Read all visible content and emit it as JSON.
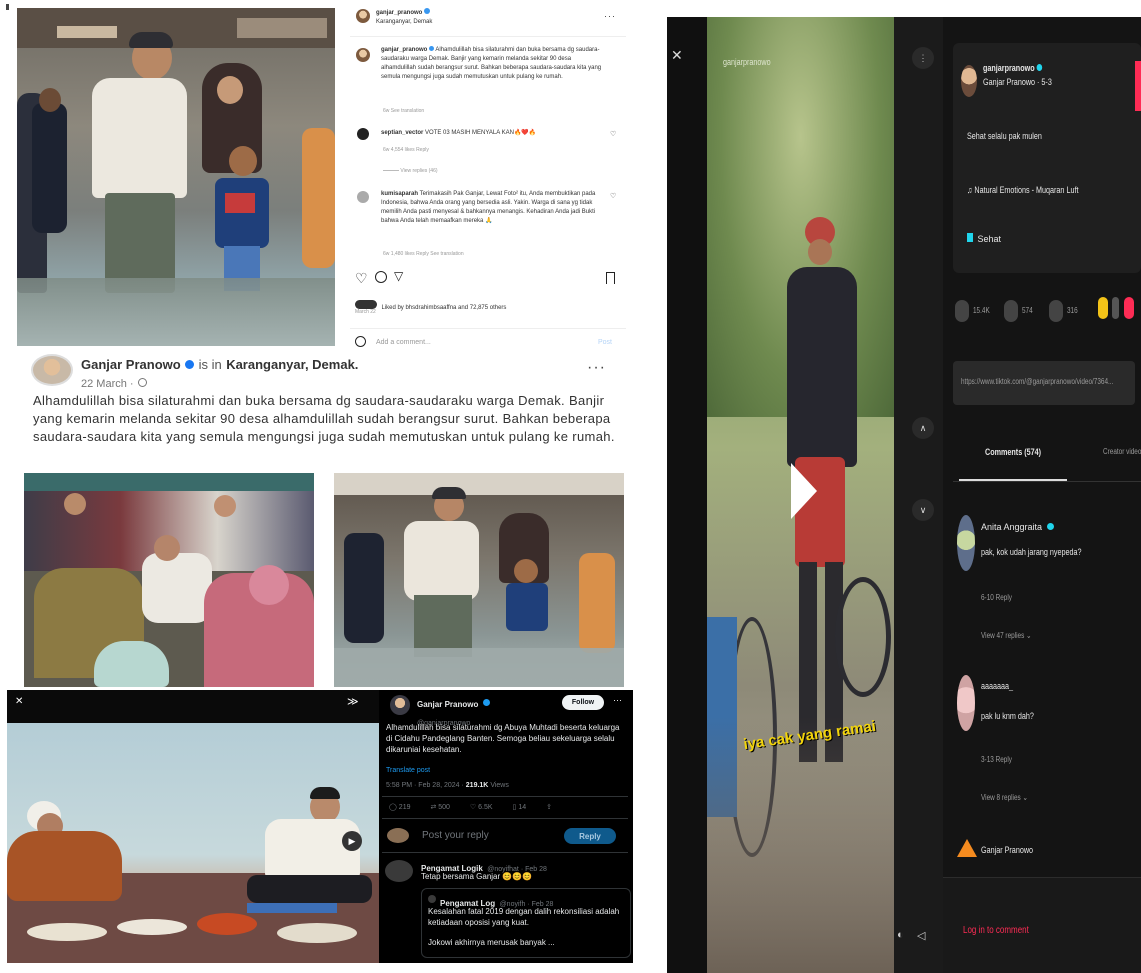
{
  "instagram": {
    "header": {
      "username": "ganjar_pranowo",
      "location": "Karanganyar, Demak"
    },
    "caption": {
      "username": "ganjar_pranowo",
      "text": "Alhamdulillah bisa silaturahmi dan buka bersama dg saudara-saudaraku warga Demak. Banjir yang kemarin melanda sekitar 90 desa alhamdulillah sudah berangsur surut. Bahkan beberapa saudara-saudara kita yang semula mengungsi juga sudah memutuskan untuk pulang ke rumah.",
      "meta": "6w   See translation"
    },
    "comments": [
      {
        "username": "septian_vector",
        "text": "VOTE 03 MASIH MENYALA KAN🔥❤️🔥",
        "meta": "6w   4,554 likes   Reply",
        "replies": "View replies (46)"
      },
      {
        "username": "kumisaparah",
        "text": "Terimakasih Pak Ganjar, Lewat Foto² itu, Anda membuktikan pada Indonesia, bahwa Anda orang yang bersedia asli. Yakin. Warga di sana yg tidak memilih Anda pasti menyesal & bahkannya menangis. Kehadiran Anda jadi Bukti bahwa Anda telah memaafkan mereka 🙏",
        "meta": "6w   1,480 likes   Reply   See translation"
      }
    ],
    "likes": "Liked by bhsdrahimbsaaffna and 72,875 others",
    "date": "March 22",
    "comment_placeholder": "Add a comment...",
    "post_label": "Post"
  },
  "facebook": {
    "name": "Ganjar Pranowo",
    "is_in": "is in",
    "location": "Karanganyar, Demak.",
    "date": "22 March ·",
    "text": "Alhamdulillah bisa silaturahmi dan buka bersama dg saudara-saudaraku warga Demak. Banjir yang kemarin melanda sekitar 90 desa alhamdulillah sudah berangsur surut. Bahkan beberapa saudara-saudara kita yang semula mengungsi juga sudah memutuskan untuk pulang ke rumah."
  },
  "twitter": {
    "name": "Ganjar Pranowo",
    "handle": "@ganjarpranowo",
    "follow_label": "Follow",
    "text": "Alhamdulillah bisa silaturahmi dg Abuya Muhtadi beserta keluarga di Cidahu Pandeglang Banten. Semoga beliau sekeluarga selalu dikaruniai kesehatan.",
    "translate": "Translate post",
    "timestamp": "5:58 PM · Feb 28, 2024 ·",
    "views": "219.1K",
    "views_label": "Views",
    "stats": {
      "replies": "219",
      "reposts": "500",
      "likes": "6.5K",
      "bookmarks": "14"
    },
    "reply_placeholder": "Post your reply",
    "reply_button": "Reply",
    "replies": [
      {
        "name": "Pengamat Logik",
        "handle": "@noyifhat · Feb 28",
        "text": "Tetap bersama Ganjar 😊😊😊"
      },
      {
        "name": "Pengamat Log",
        "handle": "@noyifh · Feb 28",
        "text": "Kesalahan fatal 2019 dengan dalih rekonsiliasi adalah ketiadaan oposisi yang kuat.",
        "more": "Jokowi akhirnya merusak banyak ..."
      }
    ]
  },
  "tiktok": {
    "overlay_user": "ganjarpranowo",
    "caption_overlay": "iya cak yang ramai",
    "author": {
      "username": "ganjarpranowo",
      "display": "Ganjar Pranowo · 5-3"
    },
    "desc": "Sehat selalu pak mulen",
    "music": "♫ Natural Emotions - Muqaran Luft",
    "tag": "Sehat",
    "link": "https://www.tiktok.com/@ganjarpranowo/video/7364...",
    "actions": [
      "15.4K",
      "574",
      "316"
    ],
    "tabs": {
      "comments": "Comments (574)",
      "creator": "Creator videos"
    },
    "comments": [
      {
        "username": "Anita Anggraita",
        "text": "pak, kok udah jarang nyepeda?",
        "meta": "6-10     Reply",
        "replies": "View 47 replies ⌄"
      },
      {
        "username": "aaaaaaa_",
        "text": "pak lu knm dah?",
        "meta": "3-13     Reply",
        "replies": "View 8 replies ⌄"
      },
      {
        "username": "Ganjar Pranowo",
        "text": "",
        "meta": "",
        "replies": ""
      }
    ],
    "login_prompt": "Log in to comment"
  }
}
